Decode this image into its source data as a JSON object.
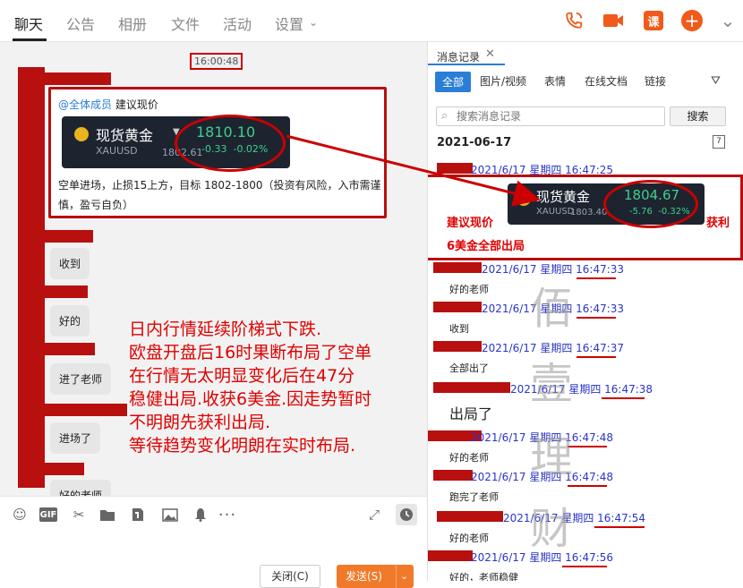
{
  "nav": {
    "tabs": [
      "聊天",
      "公告",
      "相册",
      "文件",
      "活动",
      "设置"
    ],
    "active": "聊天",
    "settings_chevron": "chevron-down-icon",
    "icons": [
      "phone-icon",
      "video-icon",
      "课",
      "plus-icon",
      "chevron-down-icon"
    ],
    "ke_label": "课",
    "accent": "#f05a1a"
  },
  "chat": {
    "timestamp": "16:00:48",
    "card": {
      "mention": "@全体成员",
      "mention_suffix": " 建议现价",
      "gold": {
        "name": "现货黄金",
        "code": "XAUUSD",
        "prev": "1802.61",
        "price": "1810.10",
        "change": "-0.33",
        "change_pct": "-0.02%"
      },
      "body": "空单进场，止损15上方，目标 1802-1800（投资有风险，入市需谨慎，盈亏自负）"
    },
    "bubbles": [
      "收到",
      "好的",
      "进了老师",
      "进场了",
      "好的老师"
    ],
    "annotation": [
      "日内行情延续阶梯式下跌.",
      "欧盘开盘后16时果断布局了空单",
      "在行情无太明显变化后在47分",
      "稳健出局.收获6美金.因走势暂时",
      "不明朗先获利出局.",
      "等待趋势变化明朗在实时布局."
    ]
  },
  "composer": {
    "tools": [
      "smile-icon",
      "gif-icon",
      "scissors-icon",
      "folder-icon",
      "file-icon",
      "image-icon",
      "bell-icon",
      "more-icon"
    ],
    "gif_label": "GIF",
    "close_label": "关闭(C)",
    "send_label": "发送(S)"
  },
  "panel": {
    "title": "消息记录",
    "filters": [
      "全部",
      "图片/视频",
      "表情",
      "在线文档",
      "链接"
    ],
    "search_placeholder": "搜索消息记录",
    "search_button": "搜索",
    "date": "2021-06-17",
    "cal_label": "7",
    "record": {
      "meta": "2021/6/17 星期四 16:47:25",
      "name": "现货黄金",
      "code": "XAUUSD",
      "prev": "1803.40",
      "price": "1804.67",
      "change": "-5.76",
      "change_pct": "-0.32%",
      "note_left": "建议现价",
      "note_right": "获利",
      "note_bottom": "6美金全部出局"
    },
    "messages": [
      {
        "meta": "2021/6/17 星期四 16:47:33",
        "text": "好的老师"
      },
      {
        "meta": "2021/6/17 星期四 16:47:33",
        "text": "收到"
      },
      {
        "meta": "2021/6/17 星期四 16:47:37",
        "text": "全部出了"
      },
      {
        "meta": "2021/6/17 星期四 16:47:38",
        "text": "出局了"
      },
      {
        "meta": "2021/6/17 星期四 16:47:48",
        "text": "好的老师"
      },
      {
        "meta": "2021/6/17 星期四 16:47:48",
        "text": "跑完了老师"
      },
      {
        "meta": "2021/6/17 星期四 16:47:54",
        "text": "好的老师"
      },
      {
        "meta": "2021/6/17 星期四 16:47:56",
        "text": "好的，老师稳健"
      }
    ],
    "watermark": [
      "佰",
      "壹",
      "理",
      "财"
    ]
  }
}
